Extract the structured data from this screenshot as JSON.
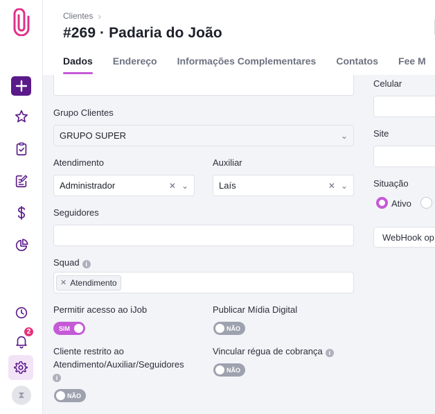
{
  "breadcrumb": {
    "parent": "Clientes"
  },
  "page": {
    "title": "#269 · Padaria do João"
  },
  "tabs": [
    {
      "label": "Dados"
    },
    {
      "label": "Endereço"
    },
    {
      "label": "Informações Complementares"
    },
    {
      "label": "Contatos"
    },
    {
      "label": "Fee M"
    }
  ],
  "sidebar": {
    "notification_count": "2"
  },
  "form": {
    "grupo_clientes": {
      "label": "Grupo Clientes",
      "value": "GRUPO SUPER"
    },
    "atendimento": {
      "label": "Atendimento",
      "value": "Administrador"
    },
    "auxiliar": {
      "label": "Auxiliar",
      "value": "Laís"
    },
    "seguidores": {
      "label": "Seguidores",
      "value": ""
    },
    "squad": {
      "label": "Squad",
      "tag": "Atendimento"
    },
    "permitir_acesso": {
      "label": "Permitir acesso ao iJob",
      "toggle": "SIM"
    },
    "publicar_midia": {
      "label": "Publicar Mídia Digital",
      "toggle": "NÃO"
    },
    "cliente_restrito": {
      "label_line1": "Cliente restrito ao",
      "label_line2": "Atendimento/Auxiliar/Seguidores",
      "toggle": "NÃO"
    },
    "vincular_regua": {
      "label": "Vincular régua de cobrança",
      "toggle": "NÃO"
    },
    "celular": {
      "label": "Celular",
      "value": ""
    },
    "site": {
      "label": "Site",
      "value": ""
    },
    "situacao": {
      "label": "Situação",
      "option_active": "Ativo"
    },
    "webhook": {
      "label": "WebHook op"
    }
  },
  "colors": {
    "accent": "#c45ad6",
    "brand": "#5a1a8a",
    "badge": "#e7317a"
  }
}
